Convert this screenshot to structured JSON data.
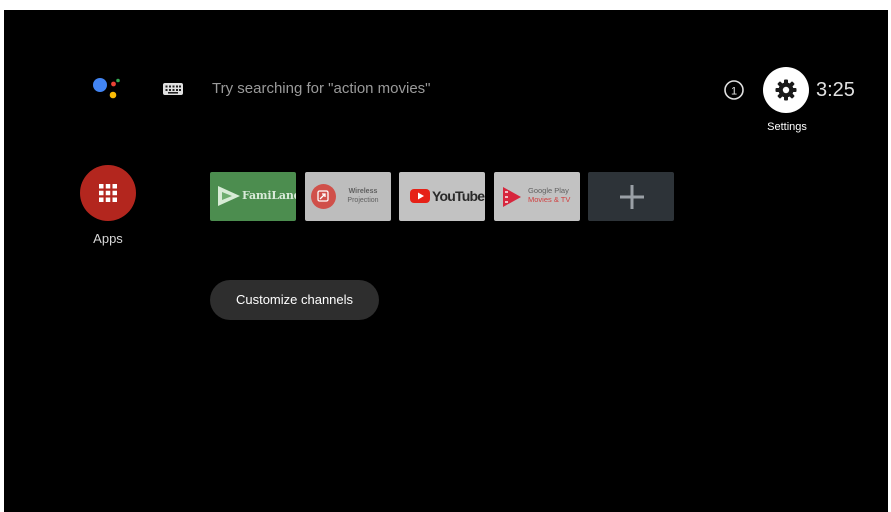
{
  "search": {
    "hint": "Try searching for \"action movies\""
  },
  "top_bar": {
    "notification_count": "1",
    "settings_label": "Settings",
    "clock": "3:25"
  },
  "apps": {
    "label": "Apps"
  },
  "channels": [
    {
      "name": "FamiLand",
      "icon": "famiLand-logo-icon",
      "color": "#4c8d4f"
    },
    {
      "name_line1": "Wireless",
      "name_line2": "Projection",
      "icon": "wireless-projection-icon",
      "color": "#bdbdbd"
    },
    {
      "name": "YouTube",
      "icon": "youtube-play-icon",
      "color": "#c2c2c2"
    },
    {
      "name_line1": "Google Play",
      "name_line2": "Movies & TV",
      "icon": "google-play-movies-icon",
      "color": "#c2c2c2"
    },
    {
      "icon": "plus-icon",
      "color": "#2d3338"
    }
  ],
  "customize": {
    "label": "Customize channels"
  },
  "colors": {
    "background": "#000000",
    "apps_button": "#b3261e",
    "settings_button": "#ffffff",
    "assistant_blue": "#4285f4",
    "assistant_red": "#ea4335",
    "assistant_yellow": "#fbbc05",
    "assistant_green": "#34a853"
  }
}
